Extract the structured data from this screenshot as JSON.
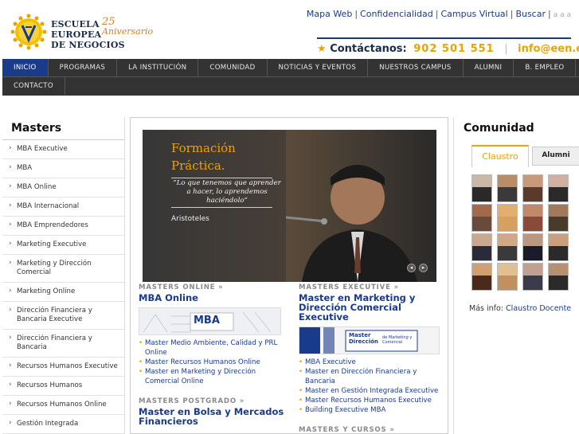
{
  "header": {
    "logo_lines": [
      "ESCUELA",
      "EUROPEA",
      "DE NEGOCIOS"
    ],
    "anniversary_number": "25",
    "anniversary_text": "Aniversario",
    "top_links": [
      "Mapa Web",
      "Confidencialidad",
      "Campus Virtual",
      "Buscar"
    ],
    "font_size_controls": "a  a  a",
    "contact_label": "Contáctanos:",
    "phone": "902 501 551",
    "email": "info@een.edu"
  },
  "nav": {
    "items": [
      "INICIO",
      "PROGRAMAS",
      "LA INSTITUCIÓN",
      "COMUNIDAD",
      "NOTICIAS Y EVENTOS",
      "NUESTROS CAMPUS",
      "ALUMNI",
      "B. EMPLEO"
    ],
    "row2": [
      "CONTACTO"
    ]
  },
  "left": {
    "title": "Masters",
    "items": [
      "MBA Executive",
      "MBA",
      "MBA Online",
      "MBA Internacional",
      "MBA Emprendedores",
      "Marketing Executive",
      "Marketing y Dirección Comercial",
      "Marketing Online",
      "Dirección Financiera y Bancaria Executive",
      "Dirección Financiera y Bancaria",
      "Recursos Humanos Executive",
      "Recursos Humanos",
      "Recursos Humanos Online",
      "Gestión Integrada"
    ]
  },
  "hero": {
    "title_line1": "Formación",
    "title_line2": "Práctica.",
    "quote": "“Lo que tenemos que aprender a hacer, lo aprendemos haciéndolo”",
    "author": "Aristoteles"
  },
  "blocks": {
    "online": {
      "category": "MASTERS ONLINE",
      "title": "MBA Online",
      "banner_label": "MBA",
      "items": [
        "Master Medio Ambiente, Calidad y PRL Online",
        "Master Recursos Humanos Online",
        "Master en Marketing y Dirección Comercial Online"
      ]
    },
    "executive": {
      "category": "MASTERS EXECUTIVE",
      "title": "Master en Marketing y Dirección Comercial Executive",
      "banner_label": "Master Dirección",
      "banner_sub": "de Marketing y Comercial",
      "items": [
        "MBA Executive",
        "Master en Dirección Financiera y Bancaria",
        "Master en Gestión Integrada Executive",
        "Master Recursos Humanos Executive",
        "Building Executive MBA"
      ]
    },
    "postgrado": {
      "category": "MASTERS POSTGRADO",
      "title": "Master en Bolsa y Mercados Financieros"
    },
    "cursos": {
      "category": "MASTERS Y CURSOS"
    }
  },
  "right": {
    "title": "Comunidad",
    "tabs": [
      "Claustro",
      "Alumni"
    ],
    "more_label": "Más info:",
    "more_link": "Claustro Docente"
  },
  "colors": {
    "accent": "#e8a400",
    "brand": "#1a3a8a",
    "nav_bg": "#333333"
  }
}
